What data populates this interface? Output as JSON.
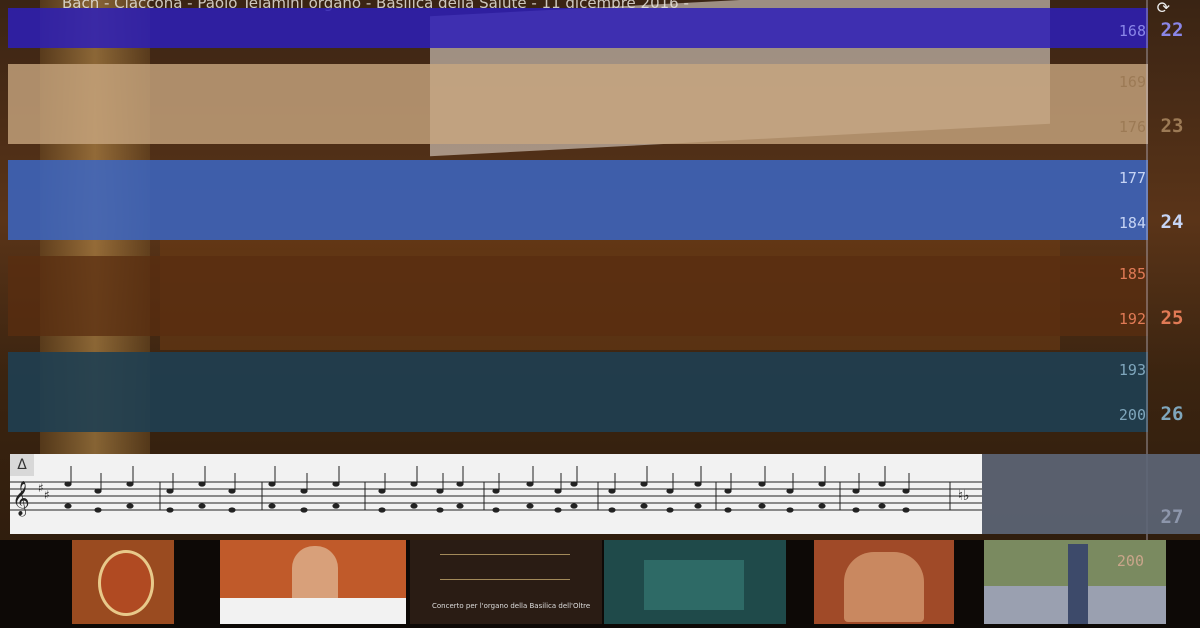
{
  "video": {
    "title": "Bach - Ciaccona - Paolo Telamini organo - Basilica della Salute - 11 dicembre 2016 -",
    "cycle_icon": "cycle-icon"
  },
  "measures": [
    {
      "top_label": "168",
      "bottom_label": "",
      "bar": "22",
      "color": "#3a2db5",
      "text": "#8a86e8"
    },
    {
      "top_label": "169",
      "bottom_label": "176",
      "bar": "23",
      "color": "#c8a680",
      "text": "#9c7a55"
    },
    {
      "top_label": "177",
      "bottom_label": "184",
      "bar": "24",
      "color": "#3b66c4",
      "text": "#c6d4f4"
    },
    {
      "top_label": "185",
      "bottom_label": "192",
      "bar": "25",
      "color": "#5a2e10",
      "text": "#e07a55"
    },
    {
      "top_label": "193",
      "bottom_label": "200",
      "bar": "26",
      "color": "#1f3f52",
      "text": "#7fa6bc"
    }
  ],
  "score": {
    "delta_label": "Δ",
    "tail_bar": "27",
    "tail_top_label": "200"
  },
  "thumbnails": [
    {
      "name": "thumb-coat-of-arms",
      "label": ""
    },
    {
      "name": "thumb-conference",
      "label": ""
    },
    {
      "name": "thumb-concert-title",
      "label": "Concerto per l'organo della Basilica dell'Oltre"
    },
    {
      "name": "thumb-organist",
      "label": ""
    },
    {
      "name": "thumb-painting",
      "label": ""
    },
    {
      "name": "thumb-outdoor",
      "label": ""
    }
  ]
}
